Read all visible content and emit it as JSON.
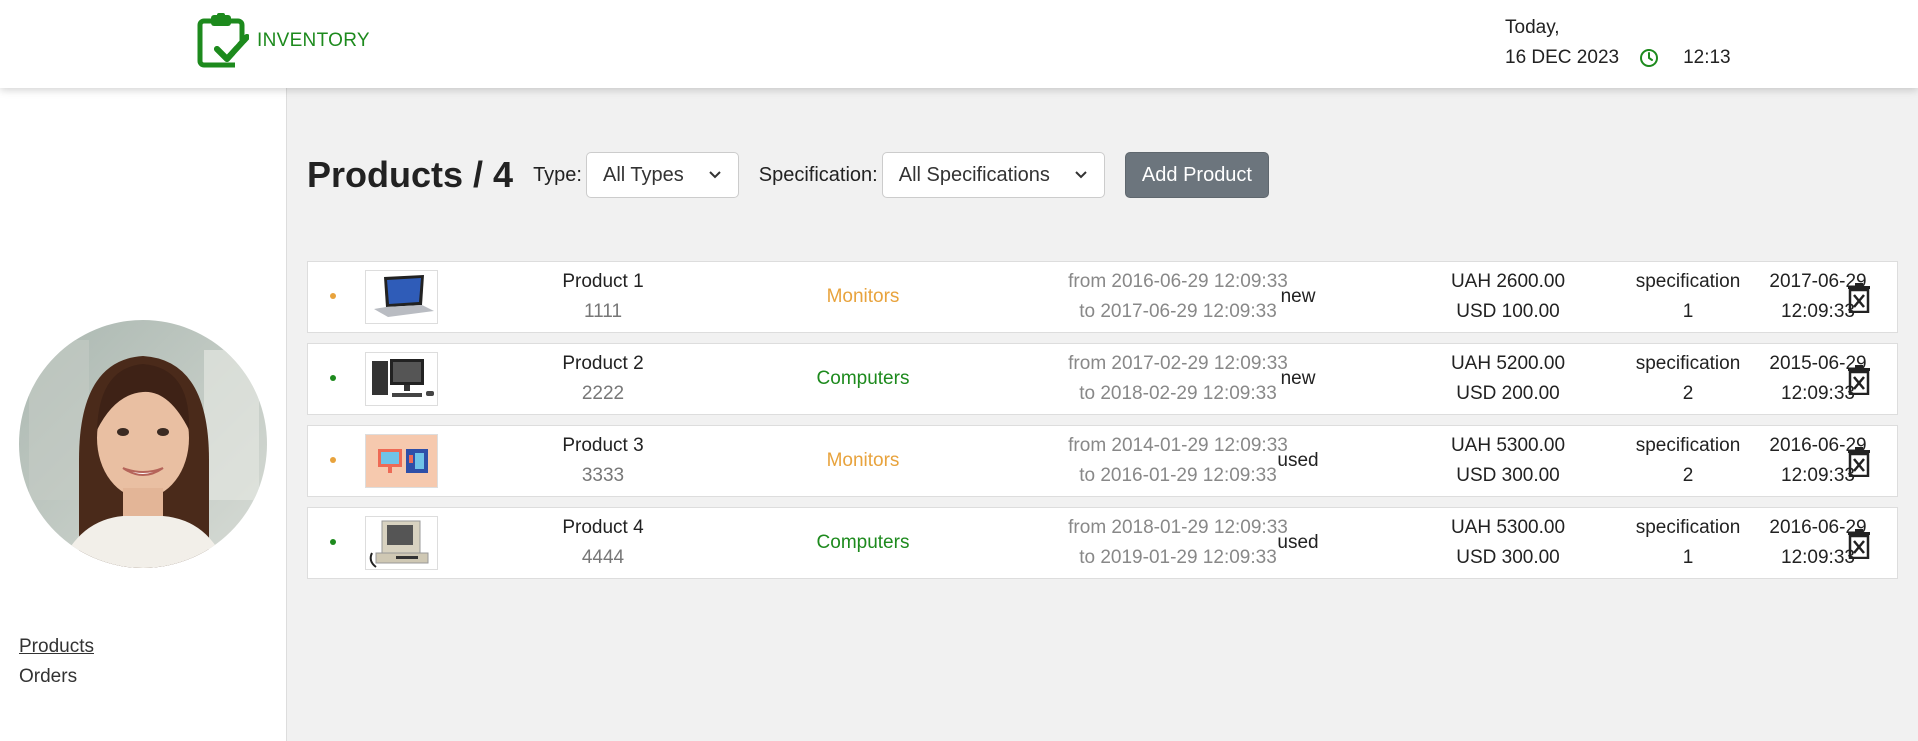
{
  "header": {
    "brand": "INVENTORY",
    "today_label": "Today,",
    "date": "16 DEC 2023",
    "time": "12:13",
    "brand_color": "#1d8a1d"
  },
  "sidebar": {
    "nav": [
      {
        "label": "Products",
        "active": true
      },
      {
        "label": "Orders",
        "active": false
      }
    ]
  },
  "toolbar": {
    "title": "Products / 4",
    "type_label": "Type:",
    "type_value": "All Types",
    "spec_label": "Specification:",
    "spec_value": "All Specifications",
    "add_label": "Add Product"
  },
  "products": [
    {
      "status_color": "#e8a33d",
      "image": "laptop-image",
      "name": "Product 1",
      "serial": "1111",
      "type": "Monitors",
      "type_color": "#e8a33d",
      "guarantee_from": "from 2016-06-29 12:09:33",
      "guarantee_to": "to 2017-06-29 12:09:33",
      "condition": "new",
      "price_uah": "UAH 2600.00",
      "price_usd": "USD 100.00",
      "spec_line1": "specification",
      "spec_line2": "1",
      "date_line1": "2017-06-29",
      "date_line2": "12:09:33"
    },
    {
      "status_color": "#1d8a1d",
      "image": "desktop-image",
      "name": "Product 2",
      "serial": "2222",
      "type": "Computers",
      "type_color": "#1d8a1d",
      "guarantee_from": "from 2017-02-29 12:09:33",
      "guarantee_to": "to 2018-02-29 12:09:33",
      "condition": "new",
      "price_uah": "UAH 5200.00",
      "price_usd": "USD 200.00",
      "spec_line1": "specification",
      "spec_line2": "2",
      "date_line1": "2015-06-29",
      "date_line2": "12:09:33"
    },
    {
      "status_color": "#e8a33d",
      "image": "monitor-illustration-image",
      "name": "Product 3",
      "serial": "3333",
      "type": "Monitors",
      "type_color": "#e8a33d",
      "guarantee_from": "from 2014-01-29 12:09:33",
      "guarantee_to": "to 2016-01-29 12:09:33",
      "condition": "used",
      "price_uah": "UAH 5300.00",
      "price_usd": "USD 300.00",
      "spec_line1": "specification",
      "spec_line2": "2",
      "date_line1": "2016-06-29",
      "date_line2": "12:09:33"
    },
    {
      "status_color": "#1d8a1d",
      "image": "retro-computer-image",
      "name": "Product 4",
      "serial": "4444",
      "type": "Computers",
      "type_color": "#1d8a1d",
      "guarantee_from": "from 2018-01-29 12:09:33",
      "guarantee_to": "to 2019-01-29 12:09:33",
      "condition": "used",
      "price_uah": "UAH 5300.00",
      "price_usd": "USD 300.00",
      "spec_line1": "specification",
      "spec_line2": "1",
      "date_line1": "2016-06-29",
      "date_line2": "12:09:33"
    }
  ]
}
